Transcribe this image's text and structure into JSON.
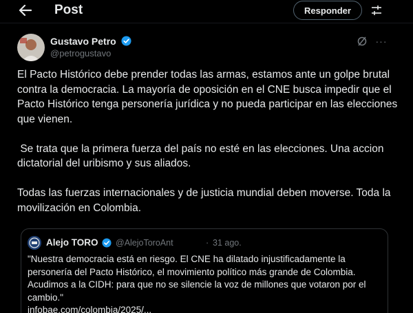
{
  "header": {
    "back_icon": "arrow-left-icon",
    "title": "Post",
    "reply_label": "Responder",
    "settings_icon": "sliders-icon"
  },
  "post": {
    "author": {
      "name": "Gustavo Petro",
      "handle": "@petrogustavo",
      "verified": true,
      "verified_color": "#1d9bf0"
    },
    "action_icons": [
      "grok-icon",
      "more-icon"
    ],
    "more_label": "···",
    "paragraphs": [
      "El Pacto Histórico debe prender todas las armas, estamos ante un golpe brutal contra la democracia. La mayoría de oposición en el CNE busca impedir que el Pacto Histórico tenga personería jurídica y no pueda participar en las elecciones que vienen.",
      " Se trata que la primera fuerza del país no esté en las elecciones. Una accion dictatorial del uribismo y sus aliados.",
      "Todas las fuerzas internacionales y de justicia mundial deben moverse. Toda la movilización en Colombia."
    ]
  },
  "quote": {
    "author_name": "Alejo TORO",
    "handle": "@AlejoToroAnt",
    "separator": "·",
    "date": "31 ago.",
    "text": "\"Nuestra democracia está en riesgo. El CNE ha dilatado injustificadamente la personería del Pacto Histórico, el movimiento político más grande de Colombia. Acudimos a la CIDH: para que no se silencie la voz de millones que votaron por el cambio.\"",
    "link": "infobae.com/colombia/2025/..."
  },
  "colors": {
    "background": "#000000",
    "text_primary": "#e7e9ea",
    "text_secondary": "#71767b",
    "border": "#2f3336",
    "accent": "#1d9bf0"
  }
}
